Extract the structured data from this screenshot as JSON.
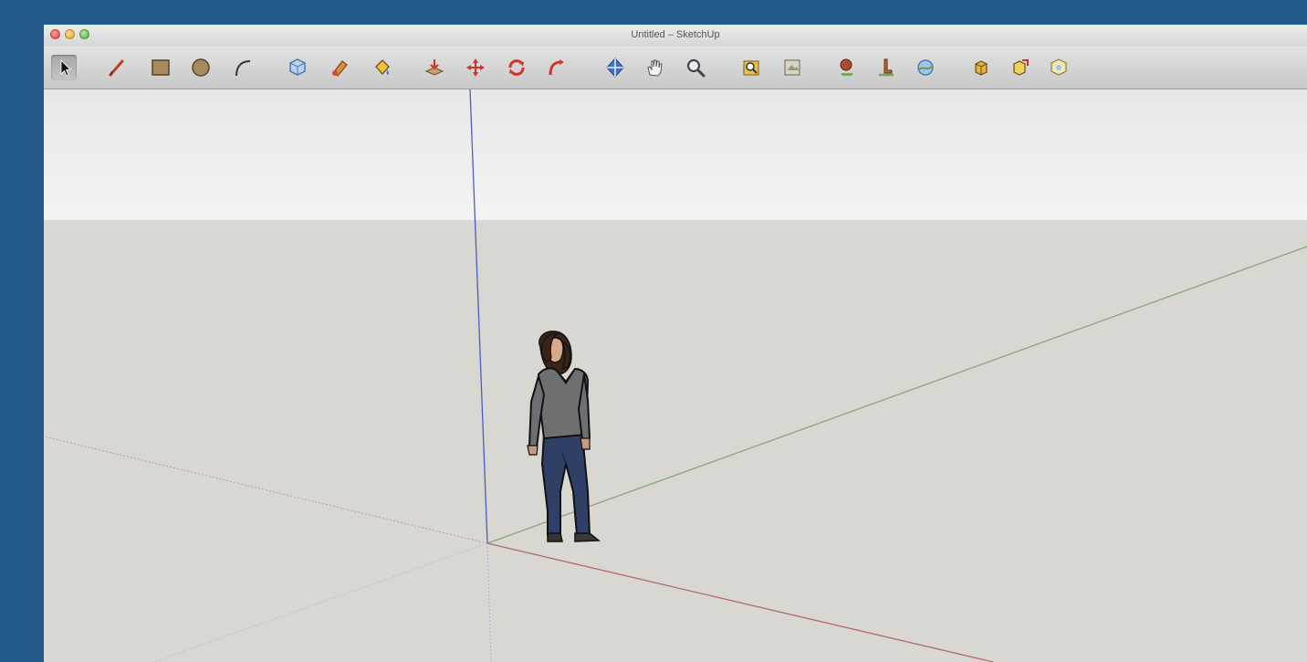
{
  "window": {
    "title": "Untitled – SketchUp"
  },
  "toolbar": {
    "tools": [
      {
        "name": "select",
        "selected": true
      },
      {
        "name": "line"
      },
      {
        "name": "rectangle"
      },
      {
        "name": "circle"
      },
      {
        "name": "arc"
      },
      {
        "name": "make-component"
      },
      {
        "name": "eraser"
      },
      {
        "name": "paint-bucket"
      },
      {
        "name": "push-pull"
      },
      {
        "name": "move"
      },
      {
        "name": "rotate"
      },
      {
        "name": "follow-me"
      },
      {
        "name": "orbit"
      },
      {
        "name": "pan"
      },
      {
        "name": "zoom"
      },
      {
        "name": "zoom-extents"
      },
      {
        "name": "previous-view"
      },
      {
        "name": "add-location"
      },
      {
        "name": "toggle-terrain"
      },
      {
        "name": "get-models"
      },
      {
        "name": "share-model"
      },
      {
        "name": "share-component"
      },
      {
        "name": "photo-textures"
      }
    ]
  },
  "scene": {
    "colors": {
      "sky": "#eeeeee",
      "ground": "#d8d7d2",
      "axis_red": "#b46a6a",
      "axis_green": "#8aa77c",
      "axis_blue": "#4a5fc8"
    },
    "figure": "person-scale-figure"
  }
}
